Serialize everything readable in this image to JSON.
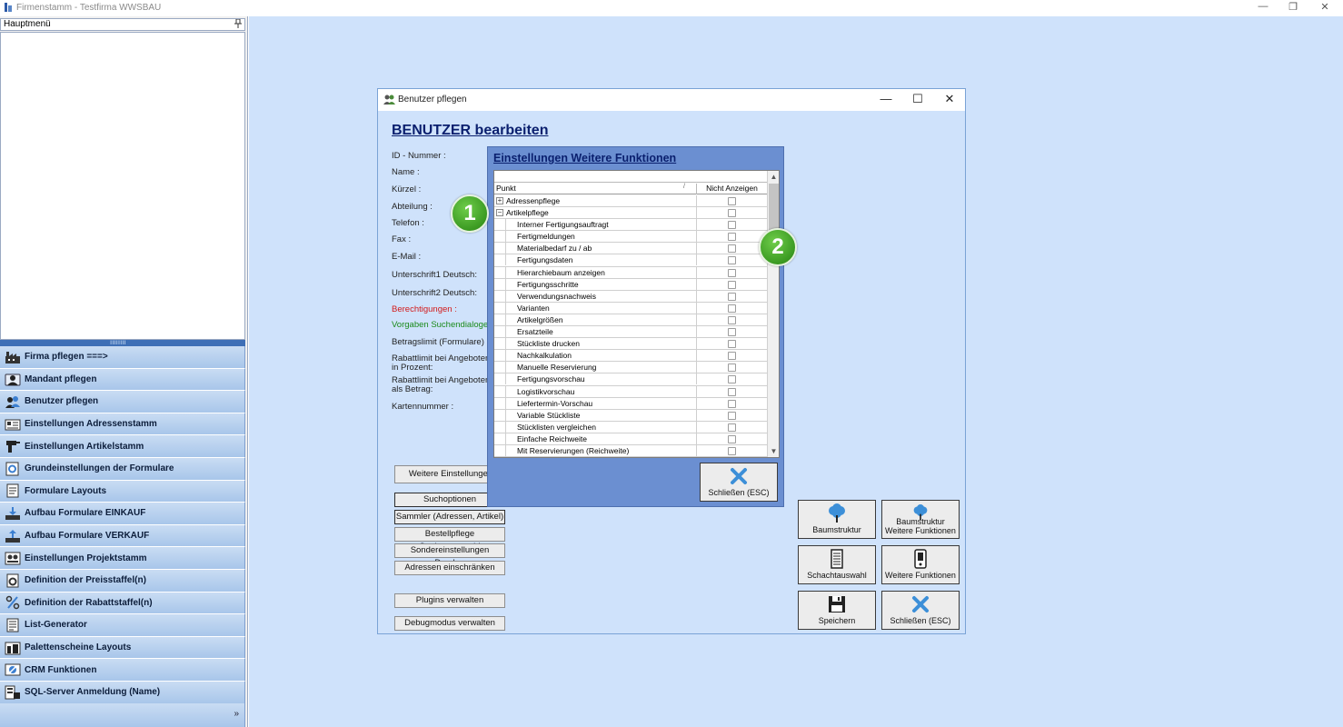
{
  "app": {
    "title": "Firmenstamm - Testfirma WWSBAU",
    "controls": {
      "minimize": "—",
      "restore": "❐",
      "close": "✕"
    }
  },
  "sidebar": {
    "header": "Hauptmenü",
    "pin": "📌",
    "splitter_grip": "ıııııııı",
    "items": [
      {
        "label": "Firma pflegen  ===>",
        "icon": "factory-icon"
      },
      {
        "label": "Mandant pflegen",
        "icon": "user-icon"
      },
      {
        "label": "Benutzer pflegen",
        "icon": "users-icon"
      },
      {
        "label": "Einstellungen Adressenstamm",
        "icon": "address-card-icon"
      },
      {
        "label": "Einstellungen Artikelstamm",
        "icon": "drill-icon"
      },
      {
        "label": "Grundeinstellungen der Formulare",
        "icon": "form-gear-icon"
      },
      {
        "label": "Formulare Layouts",
        "icon": "document-layout-icon"
      },
      {
        "label": "Aufbau Formulare EINKAUF",
        "icon": "download-tray-icon"
      },
      {
        "label": "Aufbau Formulare VERKAUF",
        "icon": "upload-tray-icon"
      },
      {
        "label": "Einstellungen Projektstamm",
        "icon": "project-icon"
      },
      {
        "label": "Definition der Preisstaffel(n)",
        "icon": "price-gear-icon"
      },
      {
        "label": "Definition der Rabattstaffel(n)",
        "icon": "percent-icon"
      },
      {
        "label": "List-Generator",
        "icon": "list-icon"
      },
      {
        "label": "Palettenscheine Layouts",
        "icon": "pallet-icon"
      },
      {
        "label": "CRM Funktionen",
        "icon": "crm-icon"
      },
      {
        "label": "SQL-Server Anmeldung (Name)",
        "icon": "server-icon"
      }
    ],
    "footer_chevron": "»"
  },
  "dialog": {
    "title": "Benutzer pflegen",
    "controls": {
      "minimize": "—",
      "maximize": "☐",
      "close": "✕"
    },
    "heading": "BENUTZER bearbeiten",
    "fields": [
      {
        "label": "ID - Nummer :",
        "color": "normal"
      },
      {
        "label": "Name :",
        "color": "normal"
      },
      {
        "label": "Kürzel :",
        "color": "normal"
      },
      {
        "label": "Abteilung :",
        "color": "normal"
      },
      {
        "label": "Telefon :",
        "color": "normal"
      },
      {
        "label": "Fax :",
        "color": "normal"
      },
      {
        "label": "E-Mail :",
        "color": "normal"
      },
      {
        "label": "Unterschrift1 Deutsch:",
        "color": "normal"
      },
      {
        "label": "Unterschrift2 Deutsch:",
        "color": "normal"
      },
      {
        "label": "Berechtigungen :",
        "color": "#d21a1a"
      },
      {
        "label": "Vorgaben Suchendialoge :",
        "color": "#1a8a1a"
      },
      {
        "label": "Betragslimit (Formulare) :",
        "color": "normal"
      },
      {
        "label": "Rabattlimit bei Angeboten",
        "color": "normal"
      },
      {
        "label": "in Prozent:",
        "color": "normal"
      },
      {
        "label": "Rabattlimit bei Angeboten",
        "color": "normal"
      },
      {
        "label": "als Betrag:",
        "color": "normal"
      },
      {
        "label": "Kartennummer :",
        "color": "normal"
      }
    ],
    "buttons": {
      "weitere": "Weitere Einstellungen",
      "suchoptionen": "Suchoptionen",
      "sammler": "Sammler (Adressen, Artikel)",
      "bestellpflege": "Bestellpflege Spaltenauswahl",
      "sonder": "Sondereinstellungen Drucker",
      "adressen": "Adressen einschränken",
      "plugins": "Plugins verwalten",
      "debug": "Debugmodus verwalten"
    },
    "big_buttons": {
      "baumstruktur": "Baumstruktur",
      "baumstruktur_weitere_1": "Baumstruktur",
      "baumstruktur_weitere_2": "Weitere Funktionen",
      "schachtauswahl": "Schachtauswahl",
      "weitere_funktionen": "Weitere Funktionen",
      "speichern": "Speichern",
      "schliessen": "Schließen (ESC)"
    }
  },
  "panel": {
    "title": "Einstellungen Weitere Funktionen",
    "columns": {
      "punkt": "Punkt",
      "sort": "/",
      "nicht_anzeigen": "Nicht Anzeigen"
    },
    "rows": [
      {
        "label": "Adressenpflege",
        "level": "group",
        "expander": "+"
      },
      {
        "label": "Artikelpflege",
        "level": "group",
        "expander": "−"
      },
      {
        "label": "Interner Fertigungsauftragt",
        "level": "child"
      },
      {
        "label": "Fertigmeldungen",
        "level": "child"
      },
      {
        "label": "Materialbedarf zu / ab",
        "level": "child"
      },
      {
        "label": "Fertigungsdaten",
        "level": "child"
      },
      {
        "label": "Hierarchiebaum anzeigen",
        "level": "child"
      },
      {
        "label": "Fertigungsschritte",
        "level": "child"
      },
      {
        "label": "Verwendungsnachweis",
        "level": "child"
      },
      {
        "label": "Varianten",
        "level": "child"
      },
      {
        "label": "Artikelgrößen",
        "level": "child"
      },
      {
        "label": "Ersatzteile",
        "level": "child"
      },
      {
        "label": "Stückliste drucken",
        "level": "child"
      },
      {
        "label": "Nachkalkulation",
        "level": "child"
      },
      {
        "label": "Manuelle Reservierung",
        "level": "child"
      },
      {
        "label": "Fertigungsvorschau",
        "level": "child"
      },
      {
        "label": "Logistikvorschau",
        "level": "child"
      },
      {
        "label": "Liefertermin-Vorschau",
        "level": "child"
      },
      {
        "label": "Variable Stückliste",
        "level": "child"
      },
      {
        "label": "Stücklisten vergleichen",
        "level": "child"
      },
      {
        "label": "Einfache Reichweite",
        "level": "child"
      },
      {
        "label": "Mit Reservierungen (Reichweite)",
        "level": "child"
      }
    ],
    "close_button": "Schließen (ESC)",
    "scroll_up": "▲",
    "scroll_down": "▼"
  },
  "badges": {
    "one": "1",
    "two": "2"
  },
  "colors": {
    "workspace": "#cfe2fb",
    "menu_gradient_top": "#c9dcf3",
    "menu_gradient_bottom": "#a8c6ea",
    "heading": "#0a1f6e",
    "panel": "#6b8fd1",
    "badge": "#3b9a22",
    "close_icon": "#3c8fd8"
  }
}
